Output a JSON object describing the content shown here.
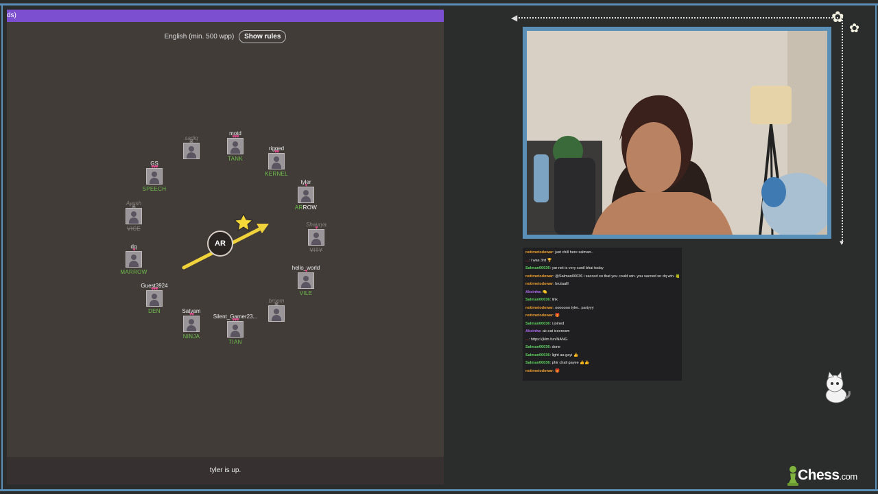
{
  "game": {
    "header_text": "ds)",
    "language_label": "English (min. 500 wpp)",
    "show_rules_label": "Show rules",
    "current_syllable": "AR",
    "status_text": "tyler is up."
  },
  "players": [
    {
      "name": "sadiq",
      "word": "",
      "hearts": "",
      "dead": true
    },
    {
      "name": "motd",
      "word": "TANK",
      "hearts": "♥♥♥",
      "dead": false
    },
    {
      "name": "rigged",
      "word": "KERNEL",
      "hearts": "♥♥",
      "dead": false
    },
    {
      "name": "tyler",
      "word_typed": "AR",
      "word_rest": "ROW",
      "hearts": "♥",
      "dead": false
    },
    {
      "name": "Shaurya",
      "word": "VITY",
      "hearts": "♥",
      "dead": true
    },
    {
      "name": "hello_world",
      "word": "VILE",
      "hearts": "♥",
      "dead": false
    },
    {
      "name": "broom",
      "word": "",
      "hearts": "",
      "dead": true
    },
    {
      "name": "Silent_Gamer23...",
      "word": "TIAN",
      "hearts": "♥♥♥",
      "dead": false
    },
    {
      "name": "Satyam",
      "word": "NINJA",
      "hearts": "♥♥",
      "dead": false
    },
    {
      "name": "Guest3924",
      "word": "DEN",
      "hearts": "♥♥♥",
      "dead": false
    },
    {
      "name": "dq",
      "word": "MARROW",
      "hearts": "♥",
      "dead": false
    },
    {
      "name": "Ayush",
      "word": "VICE",
      "hearts": "",
      "dead": true
    },
    {
      "name": "GS",
      "word": "SPEECH",
      "hearts": "♥♥♥",
      "dead": false
    }
  ],
  "chat": {
    "messages": [
      {
        "user": "notimetodowar",
        "user_color": "#f0a030",
        "text": "just chill here salman.."
      },
      {
        "user": "...",
        "user_color": "#e03030",
        "text": "i was 3rd 🏆"
      },
      {
        "user": "Salman00036",
        "user_color": "#5fd35f",
        "text": "yar net is very sunil bhai today"
      },
      {
        "user": "notimetodowar",
        "user_color": "#f0a030",
        "text": "@Salman00036 i sacced so that you could win. you sacced so dq win. 🐸"
      },
      {
        "user": "notimetodowar",
        "user_color": "#f0a030",
        "text": "brutaalll"
      },
      {
        "user": "Aksinha",
        "user_color": "#b06af0",
        "text": "🍋"
      },
      {
        "user": "Salman00036",
        "user_color": "#5fd35f",
        "text": "link"
      },
      {
        "user": "notimetodowar",
        "user_color": "#f0a030",
        "text": "ooooooo tyler.. partyyy"
      },
      {
        "user": "notimetodowar",
        "user_color": "#f0a030",
        "text": "🎁"
      },
      {
        "user": "Salman00036",
        "user_color": "#5fd35f",
        "text": "i joined"
      },
      {
        "user": "Aksinha",
        "user_color": "#b06af0",
        "text": "ak eat icecream"
      },
      {
        "user": "...",
        "user_color": "#d04040",
        "text": "https://jklm.fun/NANG"
      },
      {
        "user": "Salman00036",
        "user_color": "#5fd35f",
        "text": "done"
      },
      {
        "user": "Salman00036",
        "user_color": "#5fd35f",
        "text": "light aa gayi 👍"
      },
      {
        "user": "Salman00036",
        "user_color": "#5fd35f",
        "text": "phir chali gayee 👍👍"
      },
      {
        "user": "notimetodowar",
        "user_color": "#f0a030",
        "text": "🎁"
      }
    ]
  },
  "branding": {
    "logo_text": "Chess",
    "logo_suffix": ".com"
  },
  "colors": {
    "accent_purple": "#7b4fcf",
    "frame_blue": "#5a8fb8",
    "alive_word_green": "#6ec04a",
    "heart_pink": "#e34a8c"
  }
}
